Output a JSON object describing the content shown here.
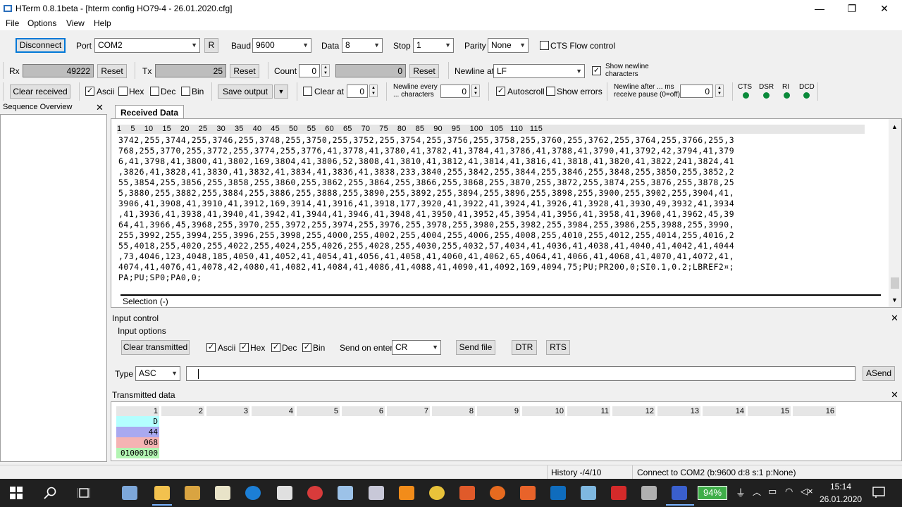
{
  "window": {
    "title": "HTerm 0.8.1beta - [hterm config HO79-4 - 26.01.2020.cfg]",
    "min": "—",
    "max": "❐",
    "close": "✕"
  },
  "menu": [
    "File",
    "Options",
    "View",
    "Help"
  ],
  "conn": {
    "disconnect": "Disconnect",
    "port_label": "Port",
    "port": "COM2",
    "r": "R",
    "baud_label": "Baud",
    "baud": "9600",
    "data_label": "Data",
    "data": "8",
    "stop_label": "Stop",
    "stop": "1",
    "parity_label": "Parity",
    "parity": "None",
    "cts_flow": "CTS Flow control"
  },
  "counters": {
    "rx_label": "Rx",
    "rx": "49222",
    "reset": "Reset",
    "tx_label": "Tx",
    "tx": "25",
    "count_label": "Count",
    "count": "0",
    "count_val": "0",
    "newline_label": "Newline at",
    "newline": "LF",
    "show_newline": "Show newline characters"
  },
  "opts": {
    "clear_received": "Clear received",
    "ascii": "Ascii",
    "hex": "Hex",
    "dec": "Dec",
    "bin": "Bin",
    "save_output": "Save output",
    "clear_at": "Clear at",
    "clear_at_val": "0",
    "newline_every": "Newline every ... characters",
    "newline_every_val": "0",
    "autoscroll": "Autoscroll",
    "show_errors": "Show errors",
    "newline_after": "Newline after ... ms receive pause (0=off)",
    "newline_after_val": "0",
    "leds": [
      "CTS",
      "DSR",
      "RI",
      "DCD"
    ]
  },
  "sequence": {
    "title": "Sequence Overview"
  },
  "received": {
    "tab": "Received Data",
    "ruler": "1    5    10    15    20    25    30    35    40    45    50    55    60    65    70    75    80    85    90    95    100   105   110   115",
    "lines": [
      "3742,255,3744,255,3746,255,3748,255,3750,255,3752,255,3754,255,3756,255,3758,255,3760,255,3762,255,3764,255,3766,255,3",
      "768,255,3770,255,3772,255,3774,255,3776,41,3778,41,3780,41,3782,41,3784,41,3786,41,3788,41,3790,41,3792,42,3794,41,379",
      "6,41,3798,41,3800,41,3802,169,3804,41,3806,52,3808,41,3810,41,3812,41,3814,41,3816,41,3818,41,3820,41,3822,241,3824,41",
      ",3826,41,3828,41,3830,41,3832,41,3834,41,3836,41,3838,233,3840,255,3842,255,3844,255,3846,255,3848,255,3850,255,3852,2",
      "55,3854,255,3856,255,3858,255,3860,255,3862,255,3864,255,3866,255,3868,255,3870,255,3872,255,3874,255,3876,255,3878,25",
      "5,3880,255,3882,255,3884,255,3886,255,3888,255,3890,255,3892,255,3894,255,3896,255,3898,255,3900,255,3902,255,3904,41,",
      "3906,41,3908,41,3910,41,3912,169,3914,41,3916,41,3918,177,3920,41,3922,41,3924,41,3926,41,3928,41,3930,49,3932,41,3934",
      ",41,3936,41,3938,41,3940,41,3942,41,3944,41,3946,41,3948,41,3950,41,3952,45,3954,41,3956,41,3958,41,3960,41,3962,45,39",
      "64,41,3966,45,3968,255,3970,255,3972,255,3974,255,3976,255,3978,255,3980,255,3982,255,3984,255,3986,255,3988,255,3990,",
      "255,3992,255,3994,255,3996,255,3998,255,4000,255,4002,255,4004,255,4006,255,4008,255,4010,255,4012,255,4014,255,4016,2",
      "55,4018,255,4020,255,4022,255,4024,255,4026,255,4028,255,4030,255,4032,57,4034,41,4036,41,4038,41,4040,41,4042,41,4044",
      ",73,4046,123,4048,185,4050,41,4052,41,4054,41,4056,41,4058,41,4060,41,4062,65,4064,41,4066,41,4068,41,4070,41,4072,41,",
      "4074,41,4076,41,4078,42,4080,41,4082,41,4084,41,4086,41,4088,41,4090,41,4092,169,4094,75;PU;PR200,0;SI0.1,0.2;LBREF2¤;",
      "PA;PU;SP0;PA0,0;"
    ],
    "selection": "Selection (-)"
  },
  "input": {
    "title": "Input control",
    "options": "Input options",
    "clear_tx": "Clear transmitted",
    "ascii": "Ascii",
    "hex": "Hex",
    "dec": "Dec",
    "bin": "Bin",
    "send_on_enter": "Send on enter",
    "send_on_enter_val": "CR",
    "send_file": "Send file",
    "dtr": "DTR",
    "rts": "RTS",
    "type_label": "Type",
    "type": "ASC",
    "asend": "ASend"
  },
  "transmitted": {
    "title": "Transmitted data",
    "cols": [
      "1",
      "2",
      "3",
      "4",
      "5",
      "6",
      "7",
      "8",
      "9",
      "10",
      "11",
      "12",
      "13",
      "14",
      "15",
      "16"
    ],
    "cells": [
      "D",
      "44",
      "068",
      "01000100"
    ]
  },
  "status": {
    "history": "History -/4/10",
    "connect": "Connect to COM2 (b:9600 d:8 s:1 p:None)"
  },
  "taskbar": {
    "battery": "94%",
    "time": "15:14",
    "date": "26.01.2020"
  }
}
